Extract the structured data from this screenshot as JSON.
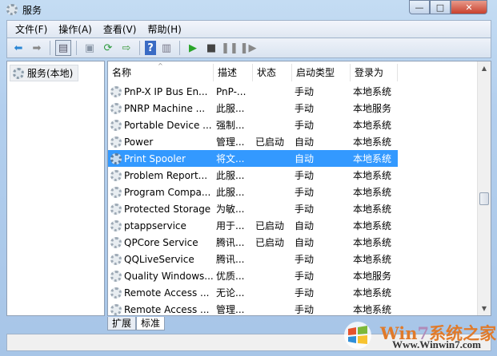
{
  "window": {
    "title": "服务",
    "minimize": "—",
    "maximize": "□",
    "close": "✕"
  },
  "menu": [
    "文件(F)",
    "操作(A)",
    "查看(V)",
    "帮助(H)"
  ],
  "left_pane": {
    "item": "服务(本地)"
  },
  "columns": [
    "名称",
    "描述",
    "状态",
    "启动类型",
    "登录为"
  ],
  "rows": [
    {
      "name": "PnP-X IP Bus En...",
      "desc": "PnP-...",
      "status": "",
      "startup": "手动",
      "logon": "本地系统"
    },
    {
      "name": "PNRP Machine ...",
      "desc": "此服...",
      "status": "",
      "startup": "手动",
      "logon": "本地服务"
    },
    {
      "name": "Portable Device ...",
      "desc": "强制...",
      "status": "",
      "startup": "手动",
      "logon": "本地系统"
    },
    {
      "name": "Power",
      "desc": "管理...",
      "status": "已启动",
      "startup": "自动",
      "logon": "本地系统"
    },
    {
      "name": "Print Spooler",
      "desc": "将文...",
      "status": "",
      "startup": "自动",
      "logon": "本地系统",
      "selected": true
    },
    {
      "name": "Problem Report...",
      "desc": "此服...",
      "status": "",
      "startup": "手动",
      "logon": "本地系统"
    },
    {
      "name": "Program Compa...",
      "desc": "此服...",
      "status": "",
      "startup": "手动",
      "logon": "本地系统"
    },
    {
      "name": "Protected Storage",
      "desc": "为敏...",
      "status": "",
      "startup": "手动",
      "logon": "本地系统"
    },
    {
      "name": "ptappservice",
      "desc": "用于...",
      "status": "已启动",
      "startup": "自动",
      "logon": "本地系统"
    },
    {
      "name": "QPCore Service",
      "desc": "腾讯...",
      "status": "已启动",
      "startup": "自动",
      "logon": "本地系统"
    },
    {
      "name": "QQLiveService",
      "desc": "腾讯...",
      "status": "",
      "startup": "手动",
      "logon": "本地系统"
    },
    {
      "name": "Quality Windows...",
      "desc": "优质...",
      "status": "",
      "startup": "手动",
      "logon": "本地服务"
    },
    {
      "name": "Remote Access ...",
      "desc": "无论...",
      "status": "",
      "startup": "手动",
      "logon": "本地系统"
    },
    {
      "name": "Remote Access ...",
      "desc": "管理...",
      "status": "",
      "startup": "手动",
      "logon": "本地系统"
    }
  ],
  "tabs": [
    "扩展",
    "标准"
  ],
  "watermark": {
    "title_a": "Win",
    "title_b": "7",
    "title_c": "系统之家",
    "url": "Www.Winwin7.com"
  }
}
